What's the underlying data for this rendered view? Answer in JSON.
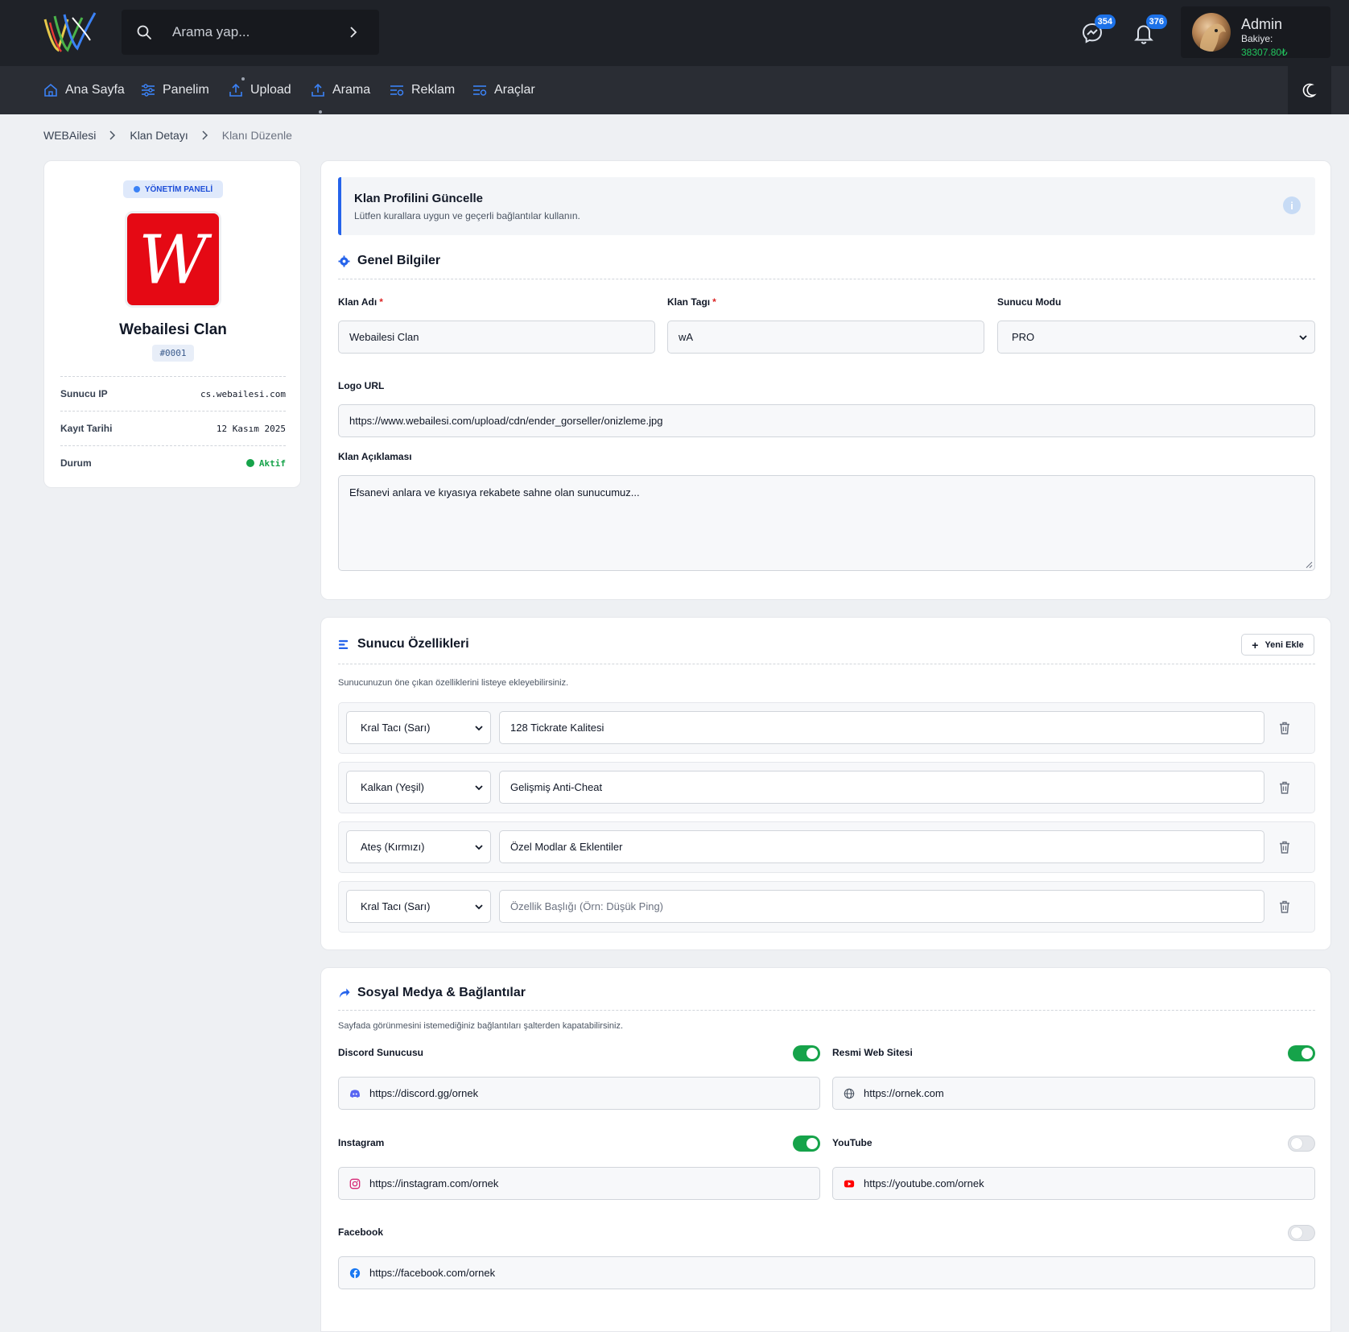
{
  "header": {
    "search_placeholder": "Arama yap...",
    "messages_count": "354",
    "notifications_count": "376",
    "user": {
      "name": "Admin",
      "balance_label": "Bakiye:",
      "balance_value": "38307.80₺"
    }
  },
  "nav": {
    "items": [
      {
        "label": "Ana Sayfa",
        "icon": "home-icon"
      },
      {
        "label": "Panelim",
        "icon": "sliders-icon"
      },
      {
        "label": "Upload",
        "icon": "upload-icon"
      },
      {
        "label": "Arama",
        "icon": "upload-icon"
      },
      {
        "label": "Reklam",
        "icon": "list-settings-icon"
      },
      {
        "label": "Araçlar",
        "icon": "list-settings-icon"
      }
    ],
    "theme_icon": "moon-icon"
  },
  "breadcrumb": [
    "WEBAilesi",
    "Klan Detayı",
    "Klanı Düzenle"
  ],
  "profile": {
    "badge": "YÖNETİM PANELİ",
    "logo_letter": "W",
    "name": "Webailesi Clan",
    "id": "#0001",
    "rows": [
      {
        "key": "Sunucu IP",
        "value": "cs.webailesi.com"
      },
      {
        "key": "Kayıt Tarihi",
        "value": "12 Kasım 2025"
      },
      {
        "key": "Durum",
        "value": "Aktif"
      }
    ]
  },
  "general": {
    "alert_title": "Klan Profilini Güncelle",
    "alert_text": "Lütfen kurallara uygun ve geçerli bağlantılar kullanın.",
    "section_title": "Genel Bilgiler",
    "clan_name_label": "Klan Adı",
    "clan_name_value": "Webailesi Clan",
    "clan_tag_label": "Klan Tagı",
    "clan_tag_value": "wA",
    "server_mode_label": "Sunucu Modu",
    "server_mode_value": "PRO",
    "logo_url_label": "Logo URL",
    "logo_url_value": "https://www.webailesi.com/upload/cdn/ender_gorseller/onizleme.jpg",
    "description_label": "Klan Açıklaması",
    "description_value": "Efsanevi anlara ve kıyasıya rekabete sahne olan sunucumuz..."
  },
  "features": {
    "section_title": "Sunucu Özellikleri",
    "add_label": "Yeni Ekle",
    "hint": "Sunucunuzun öne çıkan özelliklerini listeye ekleyebilirsiniz.",
    "rows": [
      {
        "icon": "Kral Tacı (Sarı)",
        "title": "128 Tickrate Kalitesi",
        "placeholder": ""
      },
      {
        "icon": "Kalkan (Yeşil)",
        "title": "Gelişmiş Anti-Cheat",
        "placeholder": ""
      },
      {
        "icon": "Ateş (Kırmızı)",
        "title": "Özel Modlar & Eklentiler",
        "placeholder": ""
      },
      {
        "icon": "Kral Tacı (Sarı)",
        "title": "",
        "placeholder": "Özellik Başlığı (Örn: Düşük Ping)"
      }
    ]
  },
  "social": {
    "section_title": "Sosyal Medya & Bağlantılar",
    "hint": "Sayfada görünmesini istemediğiniz bağlantıları şalterden kapatabilirsiniz.",
    "links": [
      {
        "label": "Discord Sunucusu",
        "url": "https://discord.gg/ornek",
        "enabled": true,
        "icon": "discord-icon"
      },
      {
        "label": "Resmi Web Sitesi",
        "url": "https://ornek.com",
        "enabled": true,
        "icon": "globe-icon"
      },
      {
        "label": "Instagram",
        "url": "https://instagram.com/ornek",
        "enabled": true,
        "icon": "instagram-icon"
      },
      {
        "label": "YouTube",
        "url": "https://youtube.com/ornek",
        "enabled": false,
        "icon": "youtube-icon"
      },
      {
        "label": "Facebook",
        "url": "https://facebook.com/ornek",
        "enabled": false,
        "icon": "facebook-icon"
      }
    ]
  },
  "colors": {
    "accent": "#2563eb",
    "success": "#16a34a",
    "brand_red": "#e50914",
    "topbar": "#1f2228",
    "navbar": "#2a2d34"
  }
}
